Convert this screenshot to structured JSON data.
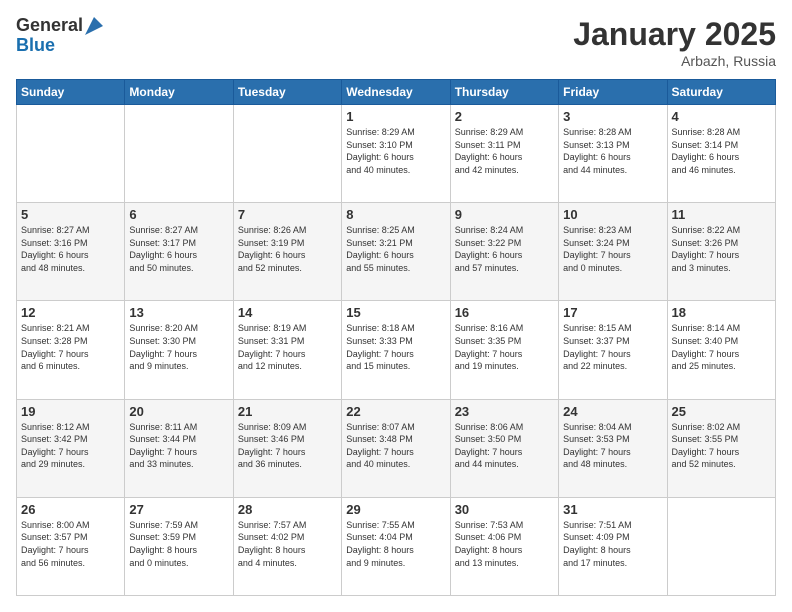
{
  "logo": {
    "general": "General",
    "blue": "Blue"
  },
  "header": {
    "month": "January 2025",
    "location": "Arbazh, Russia"
  },
  "weekdays": [
    "Sunday",
    "Monday",
    "Tuesday",
    "Wednesday",
    "Thursday",
    "Friday",
    "Saturday"
  ],
  "weeks": [
    [
      {
        "day": "",
        "info": ""
      },
      {
        "day": "",
        "info": ""
      },
      {
        "day": "",
        "info": ""
      },
      {
        "day": "1",
        "info": "Sunrise: 8:29 AM\nSunset: 3:10 PM\nDaylight: 6 hours\nand 40 minutes."
      },
      {
        "day": "2",
        "info": "Sunrise: 8:29 AM\nSunset: 3:11 PM\nDaylight: 6 hours\nand 42 minutes."
      },
      {
        "day": "3",
        "info": "Sunrise: 8:28 AM\nSunset: 3:13 PM\nDaylight: 6 hours\nand 44 minutes."
      },
      {
        "day": "4",
        "info": "Sunrise: 8:28 AM\nSunset: 3:14 PM\nDaylight: 6 hours\nand 46 minutes."
      }
    ],
    [
      {
        "day": "5",
        "info": "Sunrise: 8:27 AM\nSunset: 3:16 PM\nDaylight: 6 hours\nand 48 minutes."
      },
      {
        "day": "6",
        "info": "Sunrise: 8:27 AM\nSunset: 3:17 PM\nDaylight: 6 hours\nand 50 minutes."
      },
      {
        "day": "7",
        "info": "Sunrise: 8:26 AM\nSunset: 3:19 PM\nDaylight: 6 hours\nand 52 minutes."
      },
      {
        "day": "8",
        "info": "Sunrise: 8:25 AM\nSunset: 3:21 PM\nDaylight: 6 hours\nand 55 minutes."
      },
      {
        "day": "9",
        "info": "Sunrise: 8:24 AM\nSunset: 3:22 PM\nDaylight: 6 hours\nand 57 minutes."
      },
      {
        "day": "10",
        "info": "Sunrise: 8:23 AM\nSunset: 3:24 PM\nDaylight: 7 hours\nand 0 minutes."
      },
      {
        "day": "11",
        "info": "Sunrise: 8:22 AM\nSunset: 3:26 PM\nDaylight: 7 hours\nand 3 minutes."
      }
    ],
    [
      {
        "day": "12",
        "info": "Sunrise: 8:21 AM\nSunset: 3:28 PM\nDaylight: 7 hours\nand 6 minutes."
      },
      {
        "day": "13",
        "info": "Sunrise: 8:20 AM\nSunset: 3:30 PM\nDaylight: 7 hours\nand 9 minutes."
      },
      {
        "day": "14",
        "info": "Sunrise: 8:19 AM\nSunset: 3:31 PM\nDaylight: 7 hours\nand 12 minutes."
      },
      {
        "day": "15",
        "info": "Sunrise: 8:18 AM\nSunset: 3:33 PM\nDaylight: 7 hours\nand 15 minutes."
      },
      {
        "day": "16",
        "info": "Sunrise: 8:16 AM\nSunset: 3:35 PM\nDaylight: 7 hours\nand 19 minutes."
      },
      {
        "day": "17",
        "info": "Sunrise: 8:15 AM\nSunset: 3:37 PM\nDaylight: 7 hours\nand 22 minutes."
      },
      {
        "day": "18",
        "info": "Sunrise: 8:14 AM\nSunset: 3:40 PM\nDaylight: 7 hours\nand 25 minutes."
      }
    ],
    [
      {
        "day": "19",
        "info": "Sunrise: 8:12 AM\nSunset: 3:42 PM\nDaylight: 7 hours\nand 29 minutes."
      },
      {
        "day": "20",
        "info": "Sunrise: 8:11 AM\nSunset: 3:44 PM\nDaylight: 7 hours\nand 33 minutes."
      },
      {
        "day": "21",
        "info": "Sunrise: 8:09 AM\nSunset: 3:46 PM\nDaylight: 7 hours\nand 36 minutes."
      },
      {
        "day": "22",
        "info": "Sunrise: 8:07 AM\nSunset: 3:48 PM\nDaylight: 7 hours\nand 40 minutes."
      },
      {
        "day": "23",
        "info": "Sunrise: 8:06 AM\nSunset: 3:50 PM\nDaylight: 7 hours\nand 44 minutes."
      },
      {
        "day": "24",
        "info": "Sunrise: 8:04 AM\nSunset: 3:53 PM\nDaylight: 7 hours\nand 48 minutes."
      },
      {
        "day": "25",
        "info": "Sunrise: 8:02 AM\nSunset: 3:55 PM\nDaylight: 7 hours\nand 52 minutes."
      }
    ],
    [
      {
        "day": "26",
        "info": "Sunrise: 8:00 AM\nSunset: 3:57 PM\nDaylight: 7 hours\nand 56 minutes."
      },
      {
        "day": "27",
        "info": "Sunrise: 7:59 AM\nSunset: 3:59 PM\nDaylight: 8 hours\nand 0 minutes."
      },
      {
        "day": "28",
        "info": "Sunrise: 7:57 AM\nSunset: 4:02 PM\nDaylight: 8 hours\nand 4 minutes."
      },
      {
        "day": "29",
        "info": "Sunrise: 7:55 AM\nSunset: 4:04 PM\nDaylight: 8 hours\nand 9 minutes."
      },
      {
        "day": "30",
        "info": "Sunrise: 7:53 AM\nSunset: 4:06 PM\nDaylight: 8 hours\nand 13 minutes."
      },
      {
        "day": "31",
        "info": "Sunrise: 7:51 AM\nSunset: 4:09 PM\nDaylight: 8 hours\nand 17 minutes."
      },
      {
        "day": "",
        "info": ""
      }
    ]
  ]
}
